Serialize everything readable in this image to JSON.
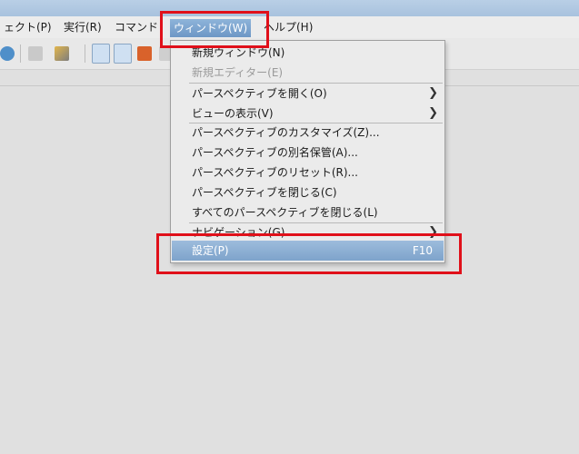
{
  "menubar": {
    "items": [
      "ェクト(P)",
      "実行(R)",
      "コマンド",
      "ウィンドウ(W)",
      "ヘルプ(H)"
    ]
  },
  "toolbar": {
    "icons": [
      "debug-icon",
      "disabled-tool-icon",
      "pencil-tool-icon",
      "outline-view-icon",
      "tree-view-icon",
      "home-icon",
      "disabled-icon"
    ]
  },
  "window_menu": {
    "items": [
      {
        "label": "新規ウィンドウ(N)"
      },
      {
        "label": "新規エディター(E)",
        "disabled": true
      },
      {
        "label": "パースペクティブを開く(O)",
        "submenu": true
      },
      {
        "label": "ビューの表示(V)",
        "submenu": true
      },
      {
        "label": "パースペクティブのカスタマイズ(Z)..."
      },
      {
        "label": "パースペクティブの別名保管(A)..."
      },
      {
        "label": "パースペクティブのリセット(R)..."
      },
      {
        "label": "パースペクティブを閉じる(C)"
      },
      {
        "label": "すべてのパースペクティブを閉じる(L)"
      },
      {
        "label": "ナビゲーション(G)",
        "submenu": true
      },
      {
        "label": "設定(P)",
        "accelerator": "F10",
        "selected": true
      }
    ],
    "submenu_arrow": "❯"
  },
  "highlight_color": "#e0101a"
}
